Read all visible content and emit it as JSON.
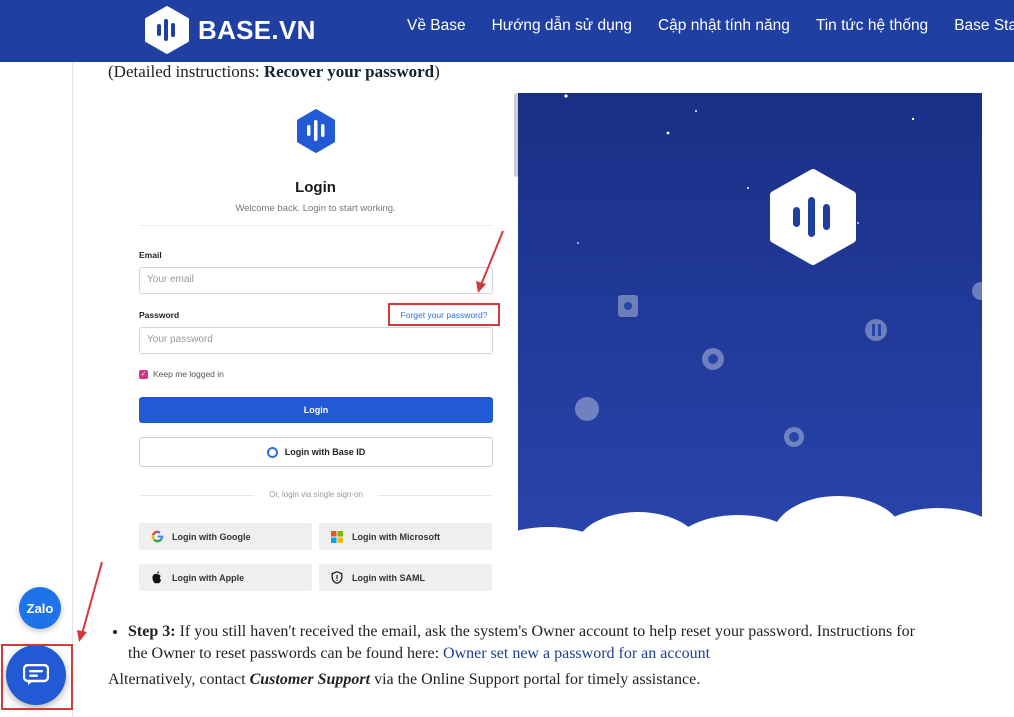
{
  "nav": {
    "brand": "BASE.VN",
    "links": [
      "Về Base",
      "Hướng dẫn sử dụng",
      "Cập nhật tính năng",
      "Tin tức hệ thống",
      "Base Status"
    ]
  },
  "intro": {
    "prefix": "(Detailed instructions: ",
    "link": "Recover your password",
    "suffix": ")"
  },
  "login": {
    "title": "Login",
    "subtitle": "Welcome back. Login to start working.",
    "email_label": "Email",
    "email_placeholder": "Your email",
    "password_label": "Password",
    "password_placeholder": "Your password",
    "forgot": "Forget your password?",
    "keep_logged": "Keep me logged in",
    "login_button": "Login",
    "baseid_button": "Login with Base ID",
    "sso_divider": "Or, login via single sign-on",
    "sso": {
      "google": "Login with Google",
      "microsoft": "Login with Microsoft",
      "apple": "Login with Apple",
      "saml": "Login with SAML"
    }
  },
  "step3": {
    "label": "Step 3:",
    "text": " If you still haven't received the email, ask the system's Owner account to help reset your password. Instructions for the Owner to reset passwords can be found here: ",
    "link": "Owner set new a password for an account"
  },
  "alt": {
    "prefix": "Alternatively, contact ",
    "emph": "Customer Support",
    "suffix": " via the Online Support portal for timely assistance."
  },
  "widgets": {
    "zalo": "Zalo"
  },
  "colors": {
    "brand_blue": "#1f3fa3",
    "primary_button": "#2259d4",
    "annotation_red": "#d23a3a",
    "illustration_bg": "#1d3490"
  }
}
